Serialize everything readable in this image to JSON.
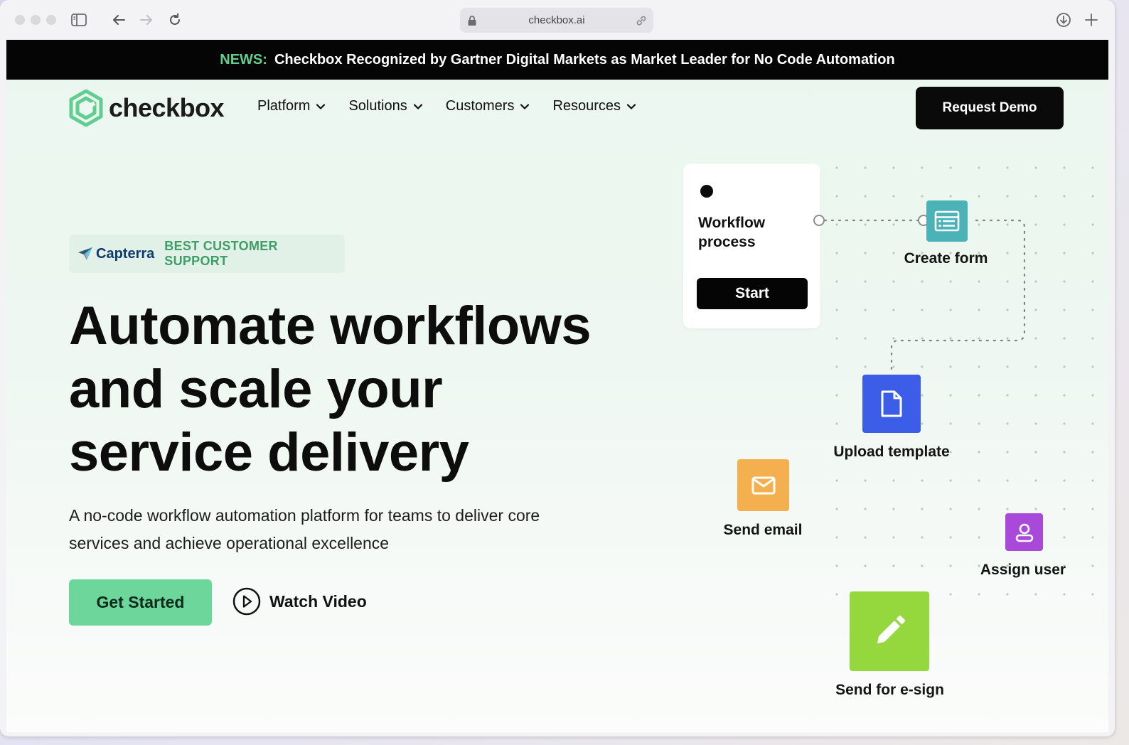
{
  "browser": {
    "url": "checkbox.ai"
  },
  "news": {
    "tag": "NEWS:",
    "text": "Checkbox Recognized by Gartner Digital Markets as Market Leader for No Code Automation"
  },
  "nav": {
    "logo_text": "checkbox",
    "items": [
      {
        "label": "Platform"
      },
      {
        "label": "Solutions"
      },
      {
        "label": "Customers"
      },
      {
        "label": "Resources"
      }
    ],
    "demo_label": "Request Demo"
  },
  "hero": {
    "badge_brand": "Capterra",
    "badge_label": "BEST CUSTOMER SUPPORT",
    "headline_lines": [
      "Automate workflows",
      "and scale your",
      "service delivery"
    ],
    "subtitle": "A no-code workflow automation platform for teams to deliver core services and achieve operational excellence",
    "cta_label": "Get Started",
    "video_label": "Watch Video"
  },
  "workflow": {
    "card_title": "Workflow process",
    "start_label": "Start",
    "nodes": [
      {
        "label": "Create form",
        "color": "#4bb3b8",
        "icon": "form-icon"
      },
      {
        "label": "Upload template",
        "color": "#3c5de8",
        "icon": "document-icon"
      },
      {
        "label": "Send email",
        "color": "#f4b04e",
        "icon": "mail-icon"
      },
      {
        "label": "Assign user",
        "color": "#a949d9",
        "icon": "user-icon"
      },
      {
        "label": "Send for e-sign",
        "color": "#95d83d",
        "icon": "pen-icon"
      }
    ]
  },
  "colors": {
    "accent_green": "#6dd69a",
    "news_green": "#5fd18e",
    "dark": "#050505"
  }
}
